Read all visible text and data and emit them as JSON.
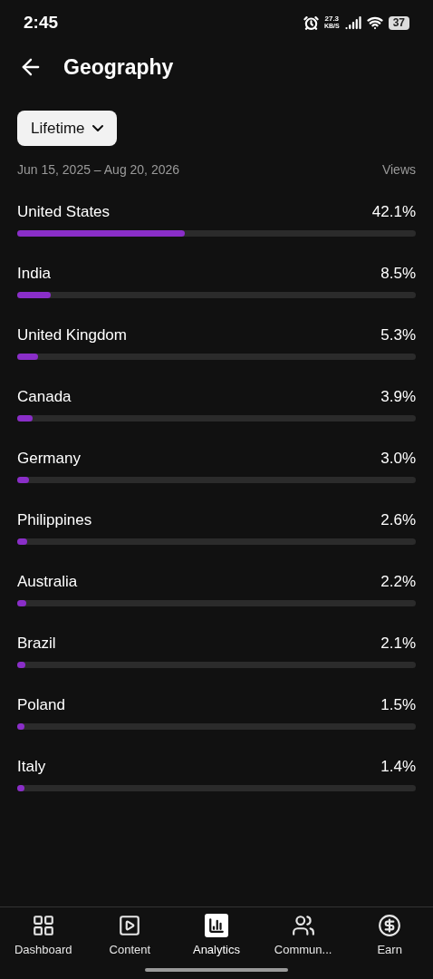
{
  "status_bar": {
    "time": "2:45",
    "speed_value": "27.3",
    "speed_unit": "KB/S",
    "battery": "37"
  },
  "header": {
    "title": "Geography"
  },
  "filter": {
    "label": "Lifetime"
  },
  "range": {
    "dates": "Jun 15, 2025 – Aug 20, 2026",
    "metric": "Views"
  },
  "countries": [
    {
      "name": "United States",
      "value": "42.1%",
      "level": 0.421
    },
    {
      "name": "India",
      "value": "8.5%",
      "level": 0.085
    },
    {
      "name": "United Kingdom",
      "value": "5.3%",
      "level": 0.053
    },
    {
      "name": "Canada",
      "value": "3.9%",
      "level": 0.039
    },
    {
      "name": "Germany",
      "value": "3.0%",
      "level": 0.03
    },
    {
      "name": "Philippines",
      "value": "2.6%",
      "level": 0.026
    },
    {
      "name": "Australia",
      "value": "2.2%",
      "level": 0.022
    },
    {
      "name": "Brazil",
      "value": "2.1%",
      "level": 0.021
    },
    {
      "name": "Poland",
      "value": "1.5%",
      "level": 0.015
    },
    {
      "name": "Italy",
      "value": "1.4%",
      "level": 0.014
    }
  ],
  "nav": [
    {
      "label": "Dashboard",
      "kind": "dashboard",
      "selected": false
    },
    {
      "label": "Content",
      "kind": "content",
      "selected": false
    },
    {
      "label": "Analytics",
      "kind": "analytics",
      "selected": true
    },
    {
      "label": "Commun...",
      "kind": "community",
      "selected": false
    },
    {
      "label": "Earn",
      "kind": "earn",
      "selected": false
    }
  ]
}
